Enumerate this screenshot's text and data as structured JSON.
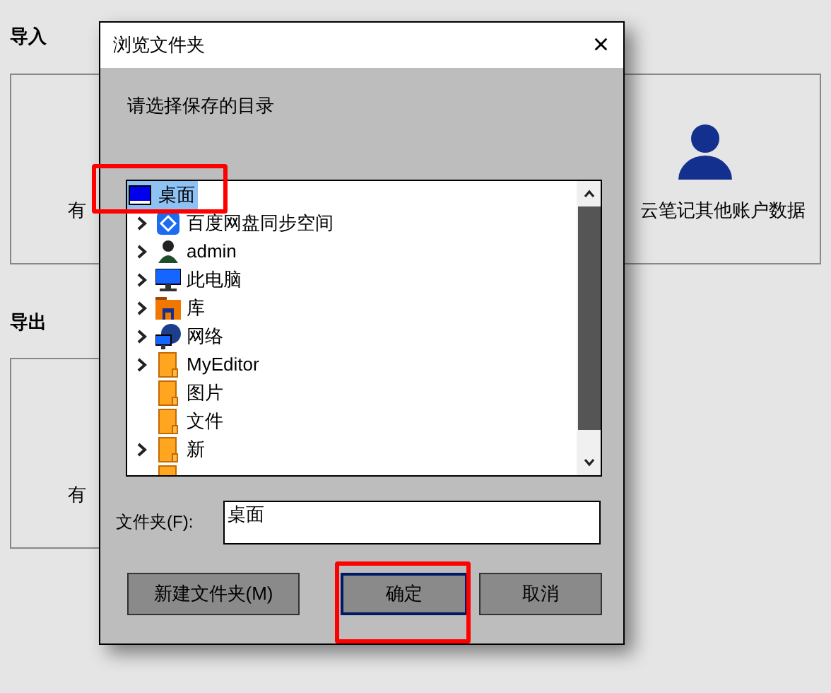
{
  "background": {
    "import_heading": "导入",
    "import_cards": [
      {
        "text": "有",
        "icon": false
      },
      {
        "text": "云笔记其他账户数据",
        "icon": true
      }
    ],
    "export_heading": "导出",
    "export_cards": [
      {
        "text": "有"
      }
    ]
  },
  "dialog": {
    "title": "浏览文件夹",
    "close": "×",
    "prompt": "请选择保存的目录",
    "tree": [
      {
        "label": "桌面",
        "kind": "desktop",
        "expandable": false,
        "selected": true,
        "highlighted": true
      },
      {
        "label": "百度网盘同步空间",
        "kind": "cloud",
        "expandable": true,
        "selected": false
      },
      {
        "label": "admin",
        "kind": "user",
        "expandable": true,
        "selected": false
      },
      {
        "label": "此电脑",
        "kind": "computer",
        "expandable": true,
        "selected": false
      },
      {
        "label": "库",
        "kind": "library",
        "expandable": true,
        "selected": false
      },
      {
        "label": "网络",
        "kind": "network",
        "expandable": true,
        "selected": false
      },
      {
        "label": "MyEditor",
        "kind": "folder",
        "expandable": true,
        "selected": false
      },
      {
        "label": "图片",
        "kind": "folder",
        "expandable": false,
        "selected": false
      },
      {
        "label": "文件",
        "kind": "folder",
        "expandable": false,
        "selected": false
      },
      {
        "label": "新",
        "kind": "folder",
        "expandable": true,
        "selected": false
      },
      {
        "kind": "folder",
        "expandable": false,
        "selected": false
      }
    ],
    "folder_label": "文件夹(F):",
    "folder_value": "桌面",
    "buttons": [
      {
        "label": "新建文件夹(M)",
        "focused": false
      },
      {
        "label": "确定",
        "focused": true,
        "highlighted": true
      },
      {
        "label": "取消",
        "focused": false
      }
    ]
  }
}
